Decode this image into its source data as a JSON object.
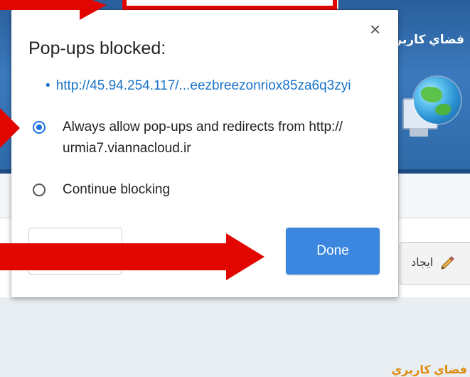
{
  "background_page": {
    "header_title": "فضاي كاربر",
    "section_title": "فضاي كاربري",
    "create_button_label": "ايجاد",
    "pencil_icon": "pencil-icon",
    "globe_icon": "globe-icon"
  },
  "popup": {
    "title": "Pop-ups blocked:",
    "close_icon": "×",
    "blocked_url": "http://45.94.254.117/...eezbreezonriox85za6q3zyi",
    "options": [
      {
        "line1": "Always allow pop-ups and redirects from http://",
        "line2": "urmia7.viannacloud.ir",
        "checked": true
      },
      {
        "line1": "Continue blocking",
        "checked": false
      }
    ],
    "done_label": "Done"
  },
  "annotation_color": "#e10600",
  "accent_color": "#1a73e8"
}
